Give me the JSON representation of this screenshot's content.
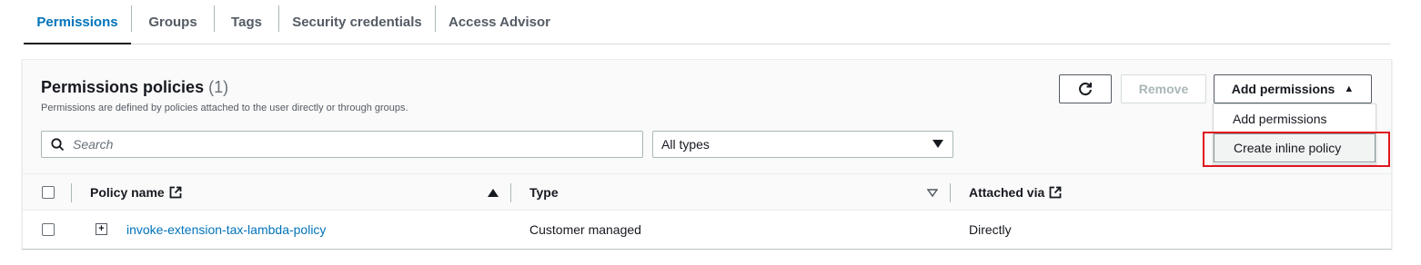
{
  "tabs": [
    {
      "label": "Permissions",
      "active": true
    },
    {
      "label": "Groups",
      "active": false
    },
    {
      "label": "Tags",
      "active": false
    },
    {
      "label": "Security credentials",
      "active": false
    },
    {
      "label": "Access Advisor",
      "active": false
    }
  ],
  "panel": {
    "title": "Permissions policies",
    "count": "(1)",
    "description": "Permissions are defined by policies attached to the user directly or through groups."
  },
  "toolbar": {
    "refresh_icon": "refresh-icon",
    "remove_label": "Remove",
    "add_label": "Add permissions"
  },
  "dropdown": {
    "items": [
      "Add permissions",
      "Create inline policy"
    ],
    "highlighted": "Create inline policy"
  },
  "filters": {
    "search_placeholder": "Search",
    "type_selected": "All types"
  },
  "table": {
    "columns": [
      "Policy name",
      "Type",
      "Attached via"
    ],
    "rows": [
      {
        "policy_name": "invoke-extension-tax-lambda-policy",
        "type": "Customer managed",
        "attached_via": "Directly"
      }
    ]
  },
  "colors": {
    "accent": "#0073bb",
    "highlight_box": "#e0141e"
  }
}
